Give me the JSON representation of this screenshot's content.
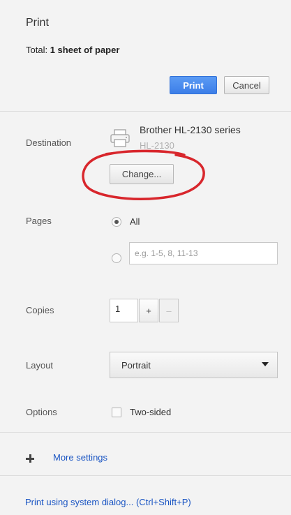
{
  "header": {
    "title": "Print",
    "summary_label": "Total:",
    "summary_value": "1 sheet of paper",
    "print_button": "Print",
    "cancel_button": "Cancel"
  },
  "destination": {
    "label": "Destination",
    "printer_name": "Brother HL-2130 series",
    "printer_model": "HL-2130",
    "change_button": "Change..."
  },
  "pages": {
    "label": "Pages",
    "all_option": "All",
    "all_selected": true,
    "custom_placeholder": "e.g. 1-5, 8, 11-13"
  },
  "copies": {
    "label": "Copies",
    "value": "1",
    "plus": "+",
    "minus": "–"
  },
  "layout": {
    "label": "Layout",
    "selected": "Portrait"
  },
  "options": {
    "label": "Options",
    "two_sided": "Two-sided",
    "two_sided_checked": false
  },
  "more_settings": "More settings",
  "system_dialog_link": "Print using system dialog... (Ctrl+Shift+P)",
  "colors": {
    "accent": "#3c7ee8",
    "link": "#1a55c3",
    "annotation": "#d8262c"
  }
}
